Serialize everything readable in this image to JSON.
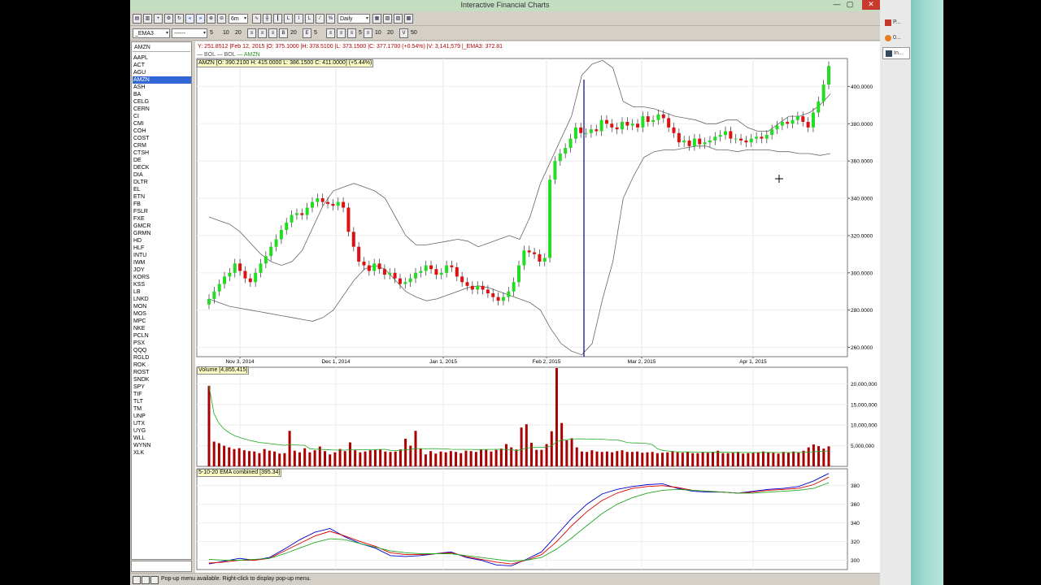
{
  "window": {
    "title": "Interactive Financial Charts",
    "minimize_glyph": "—",
    "maximize_glyph": "▢",
    "close_glyph": "✕"
  },
  "taskbar": {
    "items": [
      {
        "label": "P...",
        "icon": "app-icon",
        "color": "#c0392b"
      },
      {
        "label": "0...",
        "icon": "browser-icon",
        "color": "#e67e22"
      },
      {
        "label": "In...",
        "icon": "window-icon",
        "color": "#34495e"
      }
    ]
  },
  "toolbar1": {
    "period": "6m",
    "interval": "Daily"
  },
  "toolbar2": {
    "indicator": "_EMA3",
    "line_style": "------",
    "nums_a": [
      "5",
      "10",
      "20"
    ],
    "num_b": "20",
    "num_c": "5",
    "num_d": "5",
    "nums_e": [
      "10",
      "20"
    ],
    "num_f": "50"
  },
  "symbols": {
    "input_value": "AMZN",
    "items": [
      "AAPL",
      "ACT",
      "AGU",
      "AMZN",
      "ASH",
      "BA",
      "CELG",
      "CERN",
      "CI",
      "CMI",
      "COH",
      "COST",
      "CRM",
      "CTSH",
      "DE",
      "DECK",
      "DIA",
      "DLTR",
      "EL",
      "ETN",
      "FB",
      "FSLR",
      "FXE",
      "GMCR",
      "GRMN",
      "HD",
      "HLF",
      "INTU",
      "IWM",
      "JOY",
      "KORS",
      "KSS",
      "LB",
      "LNKD",
      "MON",
      "MOS",
      "MPC",
      "NKE",
      "PCLN",
      "PSX",
      "QQQ",
      "RGLD",
      "ROK",
      "ROST",
      "SNDK",
      "SPY",
      "TIF",
      "TLT",
      "TM",
      "UNP",
      "UTX",
      "UYG",
      "WLL",
      "WYNN",
      "XLK"
    ],
    "selected": "AMZN"
  },
  "status": {
    "text": "Pop-up menu available. Right-click to display pop-up menu."
  },
  "chart": {
    "info_line": "Y: 251.8512 |Feb 12, 2015 |O: 375.1000 |H: 378.5100 |L: 373.1500 |C: 377.1700 (+0.54%) |V: 3,141,579 |_EMA3: 372.81",
    "ohlc_label": "AMZN [O: 390.2100  H: 415.0000  L: 386.1500  C: 411.0000] (+5.44%)",
    "legend": [
      "BOL",
      "BOL",
      "AMZN"
    ],
    "volume_label": "Volume [4,855,415]",
    "ema_label": "5-10-20 EMA combined [395.34]",
    "colors": {
      "up": "#22dd22",
      "down": "#dd1111",
      "volume": "#aa0000",
      "bollinger": "#666666",
      "cursor_line": "#000080",
      "ema5": "#0000cc",
      "ema10": "#dd0000",
      "ema20": "#22aa22"
    }
  },
  "chart_data": [
    {
      "type": "candlestick",
      "title": "AMZN",
      "x_labels": [
        "Nov 3, 2014",
        "Dec 1, 2014",
        "Jan 1, 2015",
        "Feb 2, 2015",
        "Mar 2, 2015",
        "Apr 1, 2015"
      ],
      "y_ticks": [
        "260.0000",
        "280.0000",
        "300.0000",
        "320.0000",
        "340.0000",
        "360.0000",
        "380.0000",
        "400.0000"
      ],
      "ylim": [
        255,
        415
      ],
      "closes": [
        286,
        290,
        294,
        298,
        300,
        305,
        301,
        297,
        295,
        300,
        305,
        309,
        314,
        318,
        323,
        327,
        331,
        332,
        331,
        335,
        338,
        340,
        338,
        337,
        336,
        338,
        335,
        322,
        314,
        306,
        304,
        301,
        305,
        302,
        299,
        300,
        297,
        294,
        295,
        297,
        300,
        301,
        304,
        302,
        299,
        300,
        304,
        303,
        298,
        295,
        293,
        291,
        293,
        291,
        289,
        287,
        285,
        287,
        290,
        295,
        304,
        312,
        311,
        310,
        306,
        308,
        350,
        360,
        364,
        367,
        372,
        378,
        375,
        375,
        377,
        376,
        382,
        380,
        378,
        377,
        381,
        379,
        380,
        378,
        384,
        381,
        382,
        385,
        383,
        378,
        375,
        370,
        371,
        368,
        372,
        369,
        370,
        371,
        373,
        374,
        376,
        372,
        372,
        371,
        370,
        372,
        373,
        372,
        374,
        377,
        379,
        381,
        380,
        382,
        384,
        381,
        378,
        386,
        392,
        401,
        411
      ],
      "bollinger_upper": [
        330,
        328,
        326,
        322,
        316,
        310,
        306,
        304,
        306,
        312,
        324,
        336,
        344,
        346,
        348,
        346,
        344,
        340,
        330,
        320,
        315,
        315,
        316,
        317,
        318,
        317,
        314,
        316,
        318,
        320,
        318,
        330,
        348,
        360,
        372,
        384,
        406,
        412,
        414,
        410,
        392,
        389,
        389,
        388,
        386,
        384,
        383,
        382,
        380,
        380,
        382,
        382,
        378,
        376,
        376,
        380,
        384,
        384,
        386,
        390,
        396
      ],
      "bollinger_lower": [
        286,
        284,
        282,
        281,
        280,
        279,
        278,
        277,
        276,
        275,
        274,
        276,
        280,
        288,
        296,
        302,
        304,
        302,
        296,
        290,
        287,
        285,
        286,
        288,
        290,
        292,
        293,
        292,
        290,
        288,
        286,
        284,
        280,
        270,
        262,
        258,
        256,
        262,
        286,
        306,
        340,
        352,
        362,
        365,
        366,
        366,
        367,
        368,
        368,
        366,
        366,
        365,
        366,
        366,
        366,
        365,
        365,
        364,
        364,
        363,
        364
      ]
    },
    {
      "type": "bar",
      "title": "Volume",
      "y_ticks": [
        "5,000,000",
        "10,000,000",
        "15,000,000",
        "20,000,000"
      ],
      "ylim": [
        0,
        24000000
      ],
      "values": [
        19500000,
        6000000,
        5600000,
        5000000,
        4600000,
        4200000,
        4400000,
        3900000,
        3700000,
        3600000,
        3200000,
        4200000,
        3800000,
        3600000,
        3100000,
        3200000,
        8600000,
        3800000,
        3400000,
        4400000,
        3400000,
        3900000,
        4800000,
        3700000,
        2900000,
        3400000,
        4200000,
        3700000,
        5800000,
        3900000,
        3400000,
        3600000,
        3900000,
        4000000,
        4100000,
        3600000,
        3500000,
        3600000,
        4100000,
        6700000,
        5000000,
        8600000,
        4300000,
        2900000,
        3700000,
        3100000,
        3600000,
        3400000,
        3700000,
        3500000,
        3200000,
        3800000,
        3700000,
        3500000,
        4100000,
        4000000,
        3600000,
        4000000,
        4300000,
        5400000,
        4600000,
        4100000,
        9400000,
        10200000,
        5700000,
        4000000,
        4000000,
        5400000,
        8500000,
        23800000,
        10500000,
        6300000,
        6800000,
        4600000,
        3600000,
        3500000,
        3900000,
        3600000,
        3500000,
        3600000,
        3400000,
        3700000,
        3900000,
        3500000,
        3500000,
        3600000,
        3300000,
        3400000,
        3500000,
        3200000,
        3300000,
        3400000,
        3700000,
        3400000,
        3300000,
        3500000,
        3200000,
        3200000,
        3400000,
        3300000,
        3500000,
        3800000,
        3200000,
        3200000,
        3300000,
        3500000,
        3100000,
        3200000,
        3300000,
        3400000,
        3600000,
        3400000,
        3300000,
        3100000,
        3500000,
        3300000,
        3600000,
        3400000,
        3800000,
        4600000,
        5300000,
        4900000,
        4300000,
        4855415
      ]
    },
    {
      "type": "line",
      "title": "5-10-20 EMA combined",
      "y_ticks": [
        "300",
        "320",
        "340",
        "360",
        "380"
      ],
      "ylim": [
        290,
        398
      ],
      "series": [
        {
          "name": "EMA5",
          "color": "#0000cc",
          "values": [
            296,
            299,
            302,
            300,
            303,
            312,
            322,
            330,
            334,
            325,
            318,
            313,
            305,
            304,
            305,
            307,
            309,
            303,
            300,
            295,
            294,
            301,
            309,
            327,
            345,
            360,
            371,
            376,
            379,
            381,
            382,
            377,
            374,
            373,
            373,
            372,
            374,
            376,
            377,
            379,
            385,
            393
          ]
        },
        {
          "name": "EMA10",
          "color": "#dd0000",
          "values": [
            297,
            298,
            300,
            300,
            302,
            310,
            318,
            326,
            331,
            326,
            320,
            315,
            308,
            306,
            306,
            307,
            308,
            304,
            301,
            298,
            296,
            300,
            306,
            320,
            337,
            352,
            364,
            372,
            377,
            379,
            380,
            378,
            375,
            374,
            373,
            372,
            373,
            375,
            376,
            377,
            381,
            389
          ]
        },
        {
          "name": "EMA20",
          "color": "#22aa22",
          "values": [
            301,
            300,
            300,
            301,
            302,
            307,
            313,
            319,
            323,
            322,
            318,
            314,
            310,
            308,
            307,
            307,
            307,
            305,
            303,
            301,
            299,
            300,
            303,
            312,
            324,
            337,
            350,
            360,
            367,
            372,
            375,
            376,
            375,
            374,
            373,
            372,
            372,
            373,
            374,
            375,
            377,
            383
          ]
        }
      ]
    }
  ]
}
